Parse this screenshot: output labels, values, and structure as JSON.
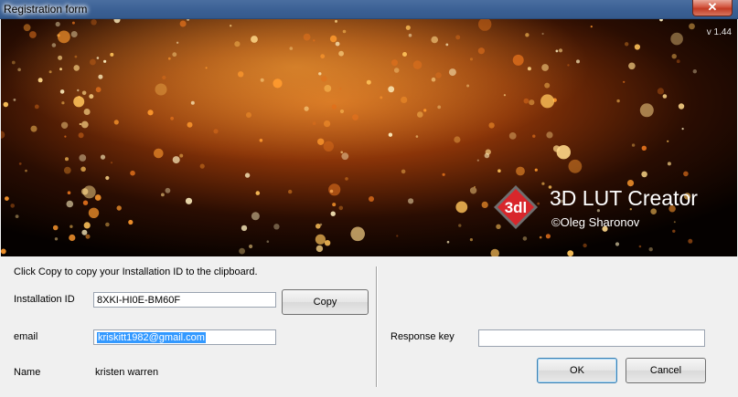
{
  "window": {
    "title": "Registration form",
    "close_glyph": "✕"
  },
  "banner": {
    "version": "v 1.44",
    "logo_text": "3dl",
    "product_name": "3D LUT Creator",
    "author": "©Oleg Sharonov"
  },
  "form": {
    "hint": "Click Copy to copy your Installation ID to the clipboard.",
    "installation_id_label": "Installation ID",
    "installation_id_value": "8XKI-HI0E-BM60F",
    "copy_button": "Copy",
    "email_label": "email",
    "email_value": "kriskitt1982@gmail.com",
    "name_label": "Name",
    "name_value": "kristen warren",
    "response_key_label": "Response key",
    "response_key_value": "",
    "ok_button": "OK",
    "cancel_button": "Cancel"
  },
  "colors": {
    "selection": "#3399ff",
    "logo_red": "#d8262b",
    "titlebar": "#3a5f93"
  }
}
